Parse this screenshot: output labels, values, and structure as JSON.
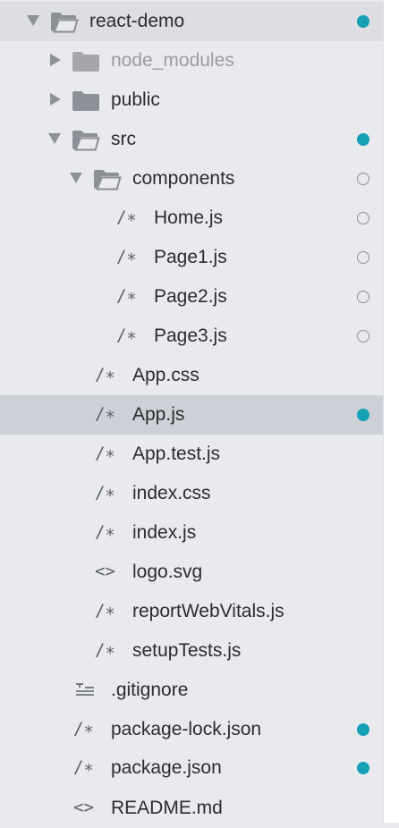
{
  "file_tree": {
    "items": [
      {
        "label": "react-demo",
        "icon": "folder-open-icon",
        "status": "modified"
      },
      {
        "label": "node_modules",
        "icon": "folder-icon",
        "status": "none"
      },
      {
        "label": "public",
        "icon": "folder-icon",
        "status": "none"
      },
      {
        "label": "src",
        "icon": "folder-open-icon",
        "status": "modified"
      },
      {
        "label": "components",
        "icon": "folder-open-icon",
        "status": "untracked"
      },
      {
        "label": "Home.js",
        "icon": "code-comment-icon",
        "icon_glyph": "/∗",
        "status": "untracked"
      },
      {
        "label": "Page1.js",
        "icon": "code-comment-icon",
        "icon_glyph": "/∗",
        "status": "untracked"
      },
      {
        "label": "Page2.js",
        "icon": "code-comment-icon",
        "icon_glyph": "/∗",
        "status": "untracked"
      },
      {
        "label": "Page3.js",
        "icon": "code-comment-icon",
        "icon_glyph": "/∗",
        "status": "untracked"
      },
      {
        "label": "App.css",
        "icon": "code-comment-icon",
        "icon_glyph": "/∗",
        "status": "none"
      },
      {
        "label": "App.js",
        "icon": "code-comment-icon",
        "icon_glyph": "/∗",
        "status": "modified"
      },
      {
        "label": "App.test.js",
        "icon": "code-comment-icon",
        "icon_glyph": "/∗",
        "status": "none"
      },
      {
        "label": "index.css",
        "icon": "code-comment-icon",
        "icon_glyph": "/∗",
        "status": "none"
      },
      {
        "label": "index.js",
        "icon": "code-comment-icon",
        "icon_glyph": "/∗",
        "status": "none"
      },
      {
        "label": "logo.svg",
        "icon": "markup-brackets-icon",
        "icon_glyph": "<>",
        "status": "none"
      },
      {
        "label": "reportWebVitals.js",
        "icon": "code-comment-icon",
        "icon_glyph": "/∗",
        "status": "none"
      },
      {
        "label": "setupTests.js",
        "icon": "code-comment-icon",
        "icon_glyph": "/∗",
        "status": "none"
      },
      {
        "label": ".gitignore",
        "icon": "text-lines-icon",
        "status": "none"
      },
      {
        "label": "package-lock.json",
        "icon": "code-comment-icon",
        "icon_glyph": "/∗",
        "status": "modified"
      },
      {
        "label": "package.json",
        "icon": "code-comment-icon",
        "icon_glyph": "/∗",
        "status": "modified"
      },
      {
        "label": "README.md",
        "icon": "markup-brackets-icon",
        "icon_glyph": "<>",
        "status": "none"
      }
    ]
  },
  "colors": {
    "background": "#e8eaed",
    "selected_row": "#cdd0d6",
    "modified_dot": "#15a0b5",
    "icon_gray": "#8e9097",
    "text": "#2b2c30",
    "dim_text": "#9a9ca2"
  }
}
